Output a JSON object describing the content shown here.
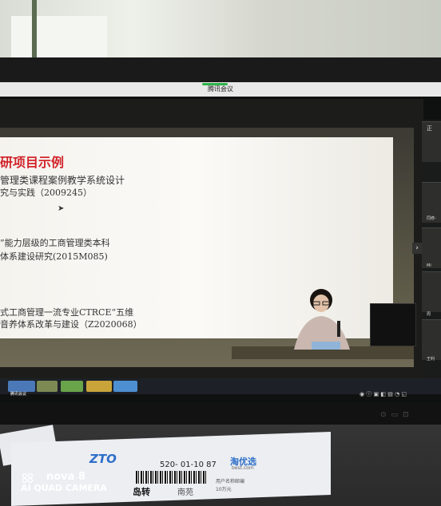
{
  "meeting": {
    "app_title": "腾讯会议"
  },
  "slide": {
    "title": "研项目示例",
    "line1": "管理类课程案例教学系统设计",
    "line2": "究与实践（2009245）",
    "line3": "”能力层级的工商管理类本科",
    "line4": "体系建设研究(2015M085)",
    "line5": "式工商管理一流专业CTRCE“五维",
    "line6": "音养体系改革与建设（Z2020068）"
  },
  "side_panel": {
    "labels": [
      "正",
      "同修-",
      "Mi",
      "周",
      "王利"
    ]
  },
  "taskbar": {
    "app_label": "腾讯会议"
  },
  "package": {
    "logo": "ZTO",
    "barcode_text": "520-  01-10  87",
    "route": "岛转",
    "route_dest": "南苑",
    "brand": "淘优选",
    "brand_site": "best.com",
    "address_1": "用户名称邮编",
    "address_2": "10万元"
  },
  "watermark": {
    "line1": "nova 8",
    "line2": "AI QUAD CAMERA"
  }
}
